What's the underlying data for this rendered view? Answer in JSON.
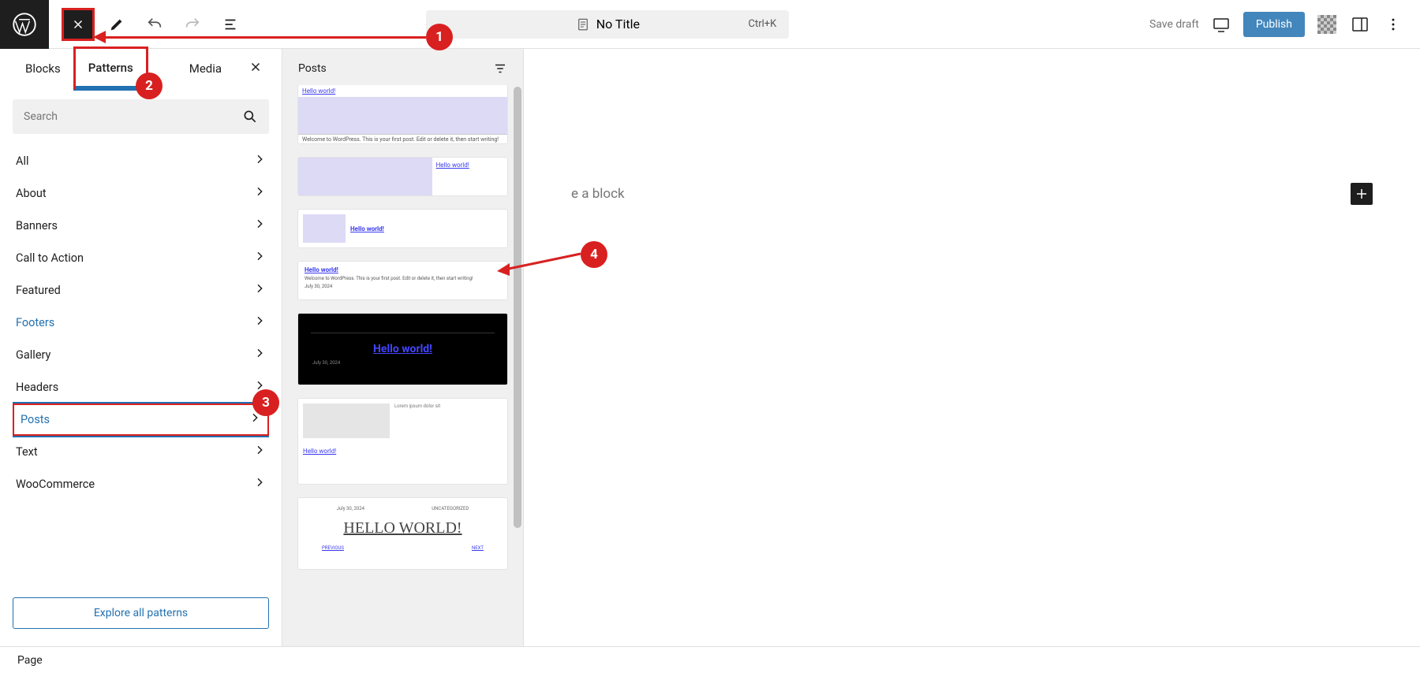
{
  "topbar": {
    "title": "No Title",
    "shortcut": "Ctrl+K",
    "save_draft": "Save draft",
    "publish": "Publish"
  },
  "tabs": {
    "blocks": "Blocks",
    "patterns": "Patterns",
    "media": "Media"
  },
  "search": {
    "placeholder": "Search"
  },
  "categories": [
    {
      "label": "All"
    },
    {
      "label": "About"
    },
    {
      "label": "Banners"
    },
    {
      "label": "Call to Action"
    },
    {
      "label": "Featured"
    },
    {
      "label": "Footers",
      "blue": true
    },
    {
      "label": "Gallery"
    },
    {
      "label": "Headers"
    },
    {
      "label": "Posts",
      "selected": true
    },
    {
      "label": "Text"
    },
    {
      "label": "WooCommerce"
    }
  ],
  "explore_label": "Explore all patterns",
  "patterns_header": "Posts",
  "pattern_samples": {
    "hello_world": "Hello world!",
    "hello_world_caps": "HELLO WORLD!",
    "lorem_short": "Welcome to WordPress. This is your first post. Edit or delete it, then start writing!",
    "date": "July 30, 2024",
    "uncat": "UNCATEGORIZED",
    "prev": "PREVIOUS",
    "next": "NEXT"
  },
  "canvas": {
    "placeholder": "e a block"
  },
  "footer": {
    "breadcrumb": "Page"
  },
  "annotations": [
    "1",
    "2",
    "3",
    "4"
  ]
}
